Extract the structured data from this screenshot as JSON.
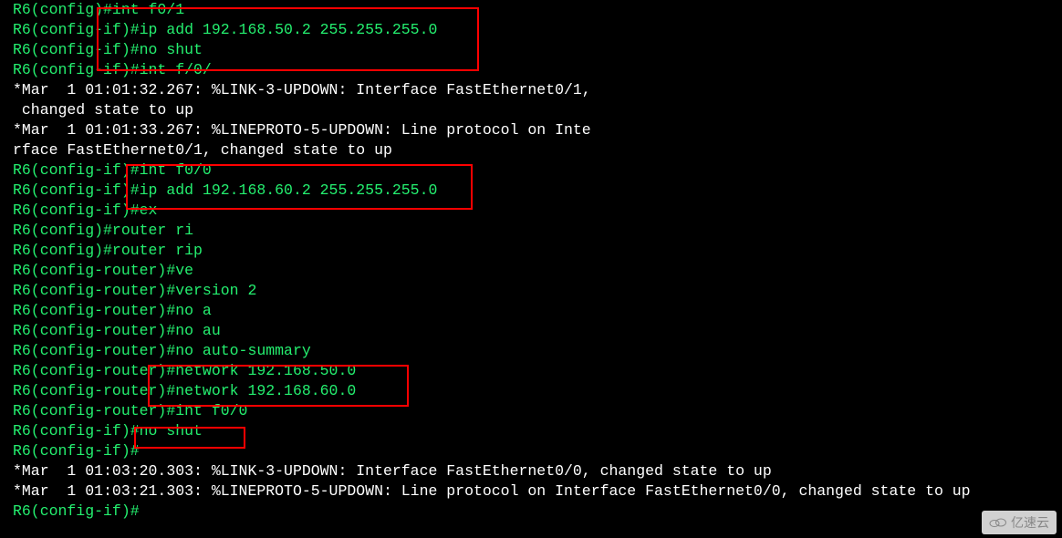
{
  "terminal": {
    "lines": [
      {
        "cls": "green",
        "text": "R6(config)#int f0/1"
      },
      {
        "cls": "green",
        "text": "R6(config-if)#ip add 192.168.50.2 255.255.255.0"
      },
      {
        "cls": "green",
        "text": "R6(config-if)#no shut"
      },
      {
        "cls": "green",
        "text": "R6(config-if)#int f/0/"
      },
      {
        "cls": "white",
        "text": "*Mar  1 01:01:32.267: %LINK-3-UPDOWN: Interface FastEthernet0/1,"
      },
      {
        "cls": "white",
        "text": " changed state to up"
      },
      {
        "cls": "white",
        "text": "*Mar  1 01:01:33.267: %LINEPROTO-5-UPDOWN: Line protocol on Inte"
      },
      {
        "cls": "white",
        "text": "rface FastEthernet0/1, changed state to up"
      },
      {
        "cls": "green",
        "text": "R6(config-if)#int f0/0"
      },
      {
        "cls": "green",
        "text": "R6(config-if)#ip add 192.168.60.2 255.255.255.0"
      },
      {
        "cls": "green",
        "text": "R6(config-if)#ex"
      },
      {
        "cls": "green",
        "text": "R6(config)#router ri"
      },
      {
        "cls": "green",
        "text": "R6(config)#router rip"
      },
      {
        "cls": "green",
        "text": "R6(config-router)#ve"
      },
      {
        "cls": "green",
        "text": "R6(config-router)#version 2"
      },
      {
        "cls": "green",
        "text": "R6(config-router)#no a"
      },
      {
        "cls": "green",
        "text": "R6(config-router)#no au"
      },
      {
        "cls": "green",
        "text": "R6(config-router)#no auto-summary"
      },
      {
        "cls": "green",
        "text": "R6(config-router)#network 192.168.50.0"
      },
      {
        "cls": "green",
        "text": "R6(config-router)#network 192.168.60.0"
      },
      {
        "cls": "green",
        "text": "R6(config-router)#int f0/0"
      },
      {
        "cls": "green",
        "text": "R6(config-if)#no shut"
      },
      {
        "cls": "green",
        "text": "R6(config-if)#"
      },
      {
        "cls": "white",
        "text": "*Mar  1 01:03:20.303: %LINK-3-UPDOWN: Interface FastEthernet0/0, changed state to up"
      },
      {
        "cls": "white",
        "text": "*Mar  1 01:03:21.303: %LINEPROTO-5-UPDOWN: Line protocol on Interface FastEthernet0/0, changed state to up"
      },
      {
        "cls": "green",
        "text": "R6(config-if)#"
      }
    ]
  },
  "watermark": {
    "text": "亿速云"
  }
}
